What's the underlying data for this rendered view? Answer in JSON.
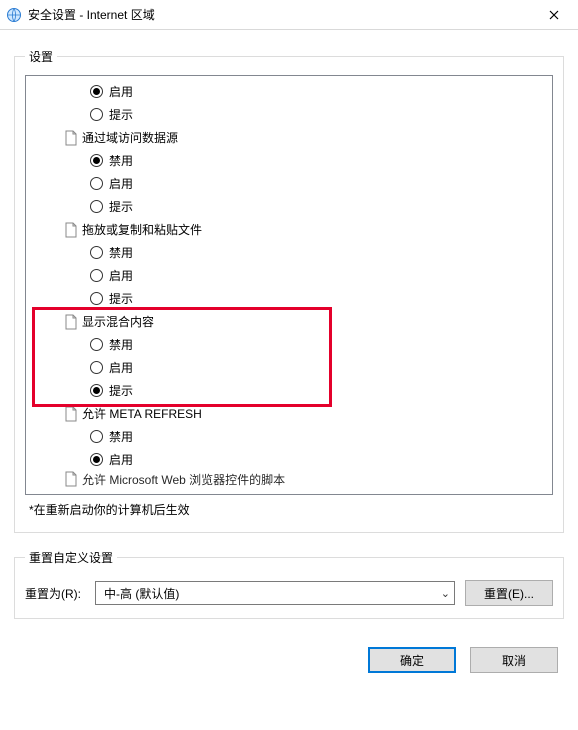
{
  "window": {
    "title": "安全设置 - Internet 区域",
    "close_aria": "关闭"
  },
  "settings": {
    "legend": "设置",
    "scroll_top_options": [
      {
        "label": "启用",
        "checked": true
      },
      {
        "label": "提示",
        "checked": false
      }
    ],
    "categories": [
      {
        "label": "通过域访问数据源",
        "options": [
          {
            "label": "禁用",
            "checked": true
          },
          {
            "label": "启用",
            "checked": false
          },
          {
            "label": "提示",
            "checked": false
          }
        ]
      },
      {
        "label": "拖放或复制和粘贴文件",
        "options": [
          {
            "label": "禁用",
            "checked": false
          },
          {
            "label": "启用",
            "checked": false
          },
          {
            "label": "提示",
            "checked": false
          }
        ]
      },
      {
        "label": "显示混合内容",
        "highlight": true,
        "options": [
          {
            "label": "禁用",
            "checked": false
          },
          {
            "label": "启用",
            "checked": false
          },
          {
            "label": "提示",
            "checked": true
          }
        ]
      },
      {
        "label": "允许 META REFRESH",
        "options": [
          {
            "label": "禁用",
            "checked": false
          },
          {
            "label": "启用",
            "checked": true
          }
        ]
      }
    ],
    "footnote": "*在重新启动你的计算机后生效"
  },
  "reset": {
    "legend": "重置自定义设置",
    "label": "重置为(R):",
    "combo_value": "中-高 (默认值)",
    "button": "重置(E)..."
  },
  "footer": {
    "ok": "确定",
    "cancel": "取消"
  }
}
